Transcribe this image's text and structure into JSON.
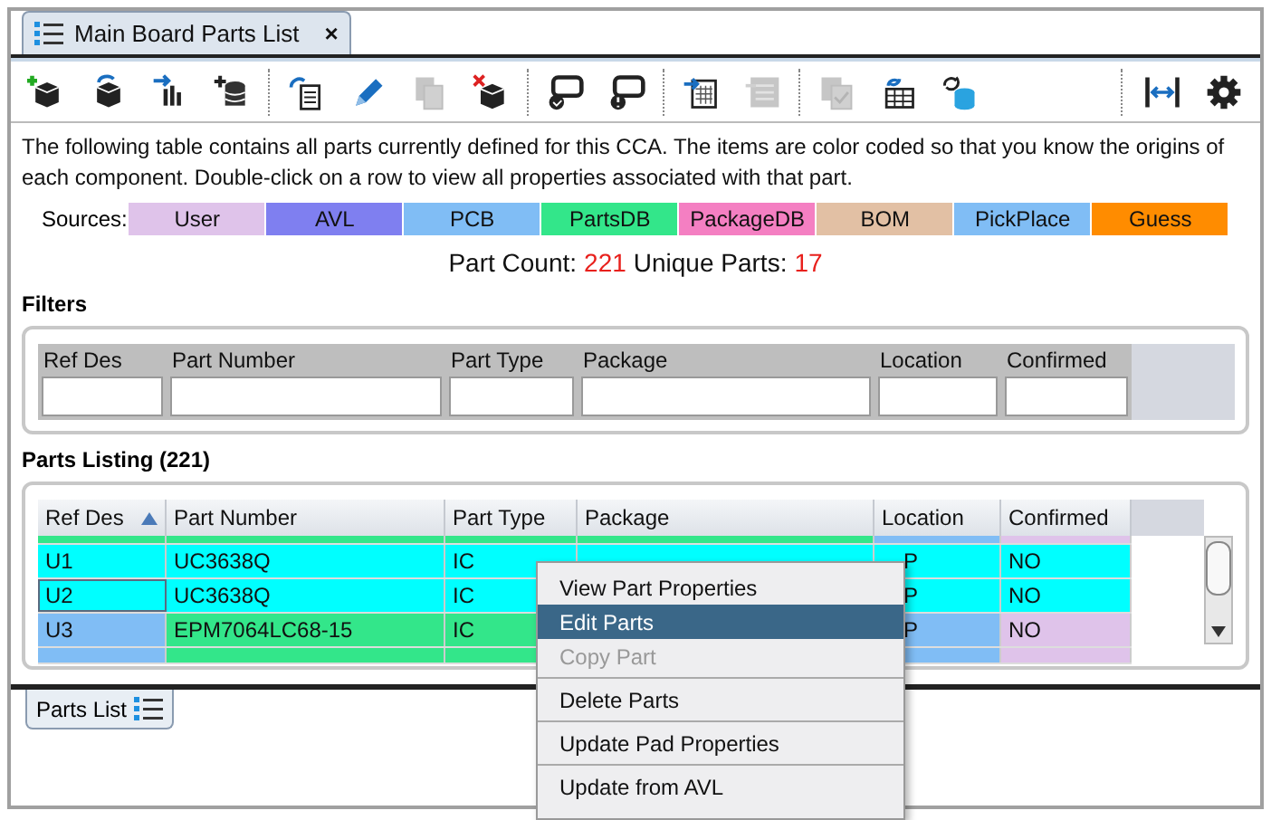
{
  "document_tab": {
    "title": "Main Board Parts List",
    "close": "×",
    "selected": true
  },
  "toolbar": {
    "groups": [
      [
        {
          "kind": "add-box",
          "disabled": false
        },
        {
          "kind": "swap-box",
          "disabled": false
        },
        {
          "kind": "import-chart",
          "disabled": false
        },
        {
          "kind": "add-db",
          "disabled": false
        }
      ],
      [
        {
          "kind": "copy-doc",
          "disabled": false
        },
        {
          "kind": "pencil",
          "disabled": false
        },
        {
          "kind": "copy",
          "disabled": true
        },
        {
          "kind": "delete-box",
          "disabled": false
        }
      ],
      [
        {
          "kind": "comment-check",
          "disabled": false
        },
        {
          "kind": "comment-info",
          "disabled": false
        }
      ],
      [
        {
          "kind": "import-table",
          "disabled": false
        },
        {
          "kind": "list",
          "disabled": true
        }
      ],
      [
        {
          "kind": "copy-check",
          "disabled": true
        },
        {
          "kind": "table-refresh",
          "disabled": false
        },
        {
          "kind": "db-refresh",
          "disabled": false
        }
      ]
    ],
    "right": [
      {
        "kind": "fit-width",
        "disabled": false
      },
      {
        "kind": "gear",
        "disabled": false
      }
    ]
  },
  "description": "The following table contains all parts currently defined for this CCA. The items are color coded so that you know the origins of each component. Double-click on a row to view all properties associated with that part.",
  "sources": {
    "label": "Sources:",
    "items": [
      {
        "name": "User",
        "color": "#dfc3ea"
      },
      {
        "name": "AVL",
        "color": "#7f7ff0"
      },
      {
        "name": "PCB",
        "color": "#80bdf5"
      },
      {
        "name": "PartsDB",
        "color": "#33e68a"
      },
      {
        "name": "PackageDB",
        "color": "#f47fc2"
      },
      {
        "name": "BOM",
        "color": "#e2c0a4"
      },
      {
        "name": "PickPlace",
        "color": "#80bdf5"
      },
      {
        "name": "Guess",
        "color": "#ff8c00"
      }
    ]
  },
  "counts": {
    "part_count_label": "Part Count:",
    "part_count": "221",
    "unique_label": "Unique Parts:",
    "unique": "17"
  },
  "filters": {
    "title": "Filters",
    "columns": [
      "Ref Des",
      "Part Number",
      "Part Type",
      "Package",
      "Location",
      "Confirmed"
    ]
  },
  "listing": {
    "title": "Parts Listing (221)",
    "columns": [
      {
        "label": "Ref Des",
        "sorted": true
      },
      {
        "label": "Part Number",
        "sorted": false
      },
      {
        "label": "Part Type",
        "sorted": false
      },
      {
        "label": "Package",
        "sorted": false
      },
      {
        "label": "Location",
        "sorted": false
      },
      {
        "label": "Confirmed",
        "sorted": false
      }
    ],
    "rows": [
      {
        "kind": "partial-top",
        "focused": false,
        "cells": [
          {
            "color": "#33e68a"
          },
          {
            "color": "#33e68a"
          },
          {
            "color": "#33e68a"
          },
          {
            "color": "#33e68a"
          },
          {
            "color": "#80bdf5"
          },
          {
            "color": "#dfc3ea"
          }
        ]
      },
      {
        "kind": "full",
        "focused": false,
        "cells": [
          {
            "text": "U1",
            "color": "#00ffff"
          },
          {
            "text": "UC3638Q",
            "color": "#00ffff"
          },
          {
            "text": "IC",
            "color": "#00ffff"
          },
          {
            "color": "#00ffff"
          },
          {
            "text": "P",
            "color": "#00ffff"
          },
          {
            "text": "NO",
            "color": "#00ffff"
          }
        ]
      },
      {
        "kind": "full",
        "focused": true,
        "cells": [
          {
            "text": "U2",
            "color": "#00ffff"
          },
          {
            "text": "UC3638Q",
            "color": "#00ffff"
          },
          {
            "text": "IC",
            "color": "#00ffff"
          },
          {},
          {
            "text": "P",
            "color": "#00ffff"
          },
          {
            "text": "NO",
            "color": "#00ffff"
          }
        ]
      },
      {
        "kind": "full",
        "focused": false,
        "cells": [
          {
            "text": "U3",
            "color": "#80bdf5"
          },
          {
            "text": "EPM7064LC68-15",
            "color": "#33e68a"
          },
          {
            "text": "IC",
            "color": "#33e68a"
          },
          {},
          {
            "text": "P",
            "color": "#80bdf5"
          },
          {
            "text": "NO",
            "color": "#dfc3ea"
          }
        ]
      },
      {
        "kind": "partial-bottom",
        "focused": false,
        "cells": [
          {
            "color": "#80bdf5"
          },
          {
            "color": "#33e68a"
          },
          {
            "color": "#33e68a"
          },
          {},
          {
            "color": "#80bdf5"
          },
          {
            "color": "#dfc3ea"
          }
        ]
      }
    ]
  },
  "bottom_tab": {
    "title": "Parts List",
    "selected": true
  },
  "context_menu": [
    {
      "label": "View Part Properties",
      "selected": false,
      "disabled": false,
      "separator_before": false
    },
    {
      "label": "Edit Parts",
      "selected": true,
      "disabled": false,
      "separator_before": false
    },
    {
      "label": "Copy Part",
      "selected": false,
      "disabled": true,
      "separator_before": false
    },
    {
      "label": "Delete Parts",
      "selected": false,
      "disabled": false,
      "separator_before": true
    },
    {
      "label": "Update Pad Properties",
      "selected": false,
      "disabled": false,
      "separator_before": true
    },
    {
      "label": "Update from AVL",
      "selected": false,
      "disabled": false,
      "separator_before": true
    }
  ]
}
